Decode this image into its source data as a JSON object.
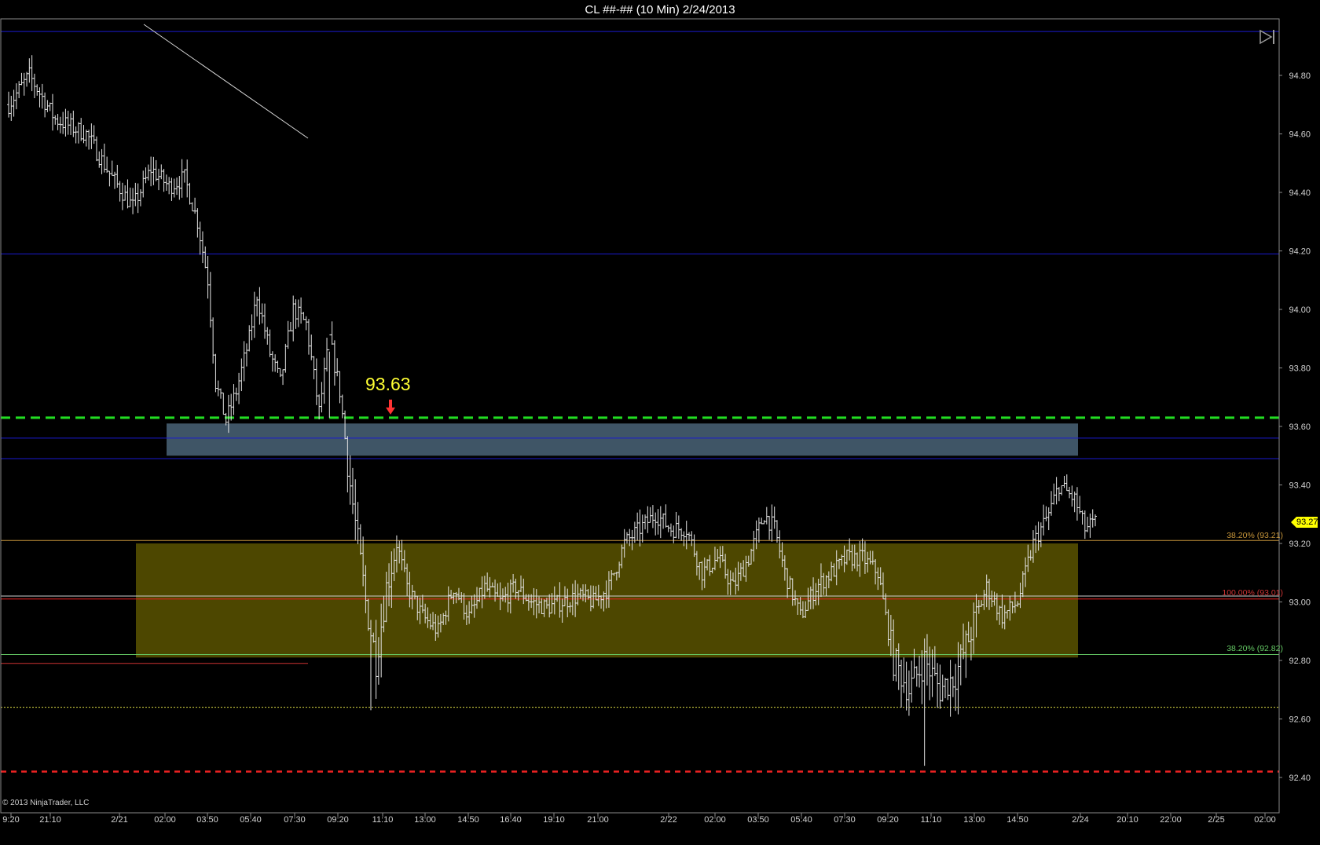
{
  "window": {
    "title": "CL ##-## (10 Min)  2/24/2013"
  },
  "footer": {
    "copyright": "© 2013 NinjaTrader, LLC"
  },
  "current_price": "93.27",
  "annotation": {
    "text": "93.63"
  },
  "fib_labels": {
    "upper": "38.20% (93.21)",
    "middle": "100.00% (93.01)",
    "lower": "38.20% (92.82)"
  },
  "colors": {
    "background": "#000000",
    "bars": "#e6e6e6",
    "blue_level": "#1a1ad0",
    "green_level": "#22dd22",
    "red_level": "#ee2222",
    "steel_zone": "#3f5566",
    "olive_zone": "#4d4700",
    "fib_orange": "#c8963a",
    "fib_red": "#cc3333",
    "fib_green": "#66cc66"
  },
  "chart_data": {
    "type": "bar",
    "subtype": "ohlc",
    "title": "CL ##-## (10 Min)  2/24/2013",
    "ylim": [
      92.24,
      94.98
    ],
    "y_ticks": [
      "94.80",
      "94.60",
      "94.40",
      "94.20",
      "94.00",
      "93.80",
      "93.60",
      "93.40",
      "93.20",
      "93.00",
      "92.80",
      "92.60",
      "92.40"
    ],
    "x_ticks": [
      "9:20",
      "21:10",
      "2/21",
      "02:00",
      "03:50",
      "05:40",
      "07:30",
      "09:20",
      "11:10",
      "13:00",
      "14:50",
      "16:40",
      "19:10",
      "21:00",
      "2/22",
      "02:00",
      "03:50",
      "05:40",
      "07:30",
      "09:20",
      "11:10",
      "13:00",
      "14:50",
      "2/24",
      "20:10",
      "22:00",
      "2/25",
      "02:00"
    ],
    "grid": false,
    "horizontal_levels": [
      {
        "price": 94.95,
        "style": "solid",
        "color": "blue"
      },
      {
        "price": 94.19,
        "style": "solid",
        "color": "blue"
      },
      {
        "price": 93.63,
        "style": "dashed",
        "color": "green"
      },
      {
        "price": 93.56,
        "style": "solid",
        "color": "blue"
      },
      {
        "price": 93.49,
        "style": "solid",
        "color": "blue"
      },
      {
        "price": 93.21,
        "style": "solid",
        "color": "orange"
      },
      {
        "price": 93.01,
        "style": "solid",
        "color": "red"
      },
      {
        "price": 92.82,
        "style": "solid",
        "color": "green"
      },
      {
        "price": 92.64,
        "style": "dotted",
        "color": "yellow"
      },
      {
        "price": 92.42,
        "style": "dashed",
        "color": "red"
      }
    ],
    "zones": [
      {
        "name": "steel",
        "price_top": 93.61,
        "price_bottom": 93.5
      },
      {
        "name": "olive",
        "price_top": 93.2,
        "price_bottom": 92.81
      }
    ],
    "callout_price": 93.63,
    "last_price": 93.27,
    "anchors": [
      {
        "i": 0,
        "p": 94.7
      },
      {
        "i": 8,
        "p": 94.8
      },
      {
        "i": 18,
        "p": 94.65
      },
      {
        "i": 30,
        "p": 94.6
      },
      {
        "i": 40,
        "p": 94.45
      },
      {
        "i": 48,
        "p": 94.35
      },
      {
        "i": 55,
        "p": 94.48
      },
      {
        "i": 62,
        "p": 94.42
      },
      {
        "i": 68,
        "p": 94.45
      },
      {
        "i": 73,
        "p": 94.3
      },
      {
        "i": 77,
        "p": 94.1
      },
      {
        "i": 80,
        "p": 93.75
      },
      {
        "i": 84,
        "p": 93.62
      },
      {
        "i": 88,
        "p": 93.72
      },
      {
        "i": 93,
        "p": 93.9
      },
      {
        "i": 96,
        "p": 94.05
      },
      {
        "i": 101,
        "p": 93.85
      },
      {
        "i": 105,
        "p": 93.75
      },
      {
        "i": 110,
        "p": 94.0
      },
      {
        "i": 115,
        "p": 93.95
      },
      {
        "i": 120,
        "p": 93.65
      },
      {
        "i": 124,
        "p": 93.9
      },
      {
        "i": 128,
        "p": 93.72
      },
      {
        "i": 132,
        "p": 93.4
      },
      {
        "i": 138,
        "p": 93.0
      },
      {
        "i": 142,
        "p": 92.8
      },
      {
        "i": 146,
        "p": 93.05
      },
      {
        "i": 150,
        "p": 93.2
      },
      {
        "i": 154,
        "p": 93.05
      },
      {
        "i": 160,
        "p": 92.95
      },
      {
        "i": 166,
        "p": 92.9
      },
      {
        "i": 172,
        "p": 93.05
      },
      {
        "i": 178,
        "p": 92.95
      },
      {
        "i": 184,
        "p": 93.05
      },
      {
        "i": 190,
        "p": 93.0
      },
      {
        "i": 196,
        "p": 93.05
      },
      {
        "i": 202,
        "p": 93.0
      },
      {
        "i": 208,
        "p": 92.98
      },
      {
        "i": 214,
        "p": 93.0
      },
      {
        "i": 220,
        "p": 93.02
      },
      {
        "i": 226,
        "p": 93.0
      },
      {
        "i": 232,
        "p": 93.05
      },
      {
        "i": 238,
        "p": 93.2
      },
      {
        "i": 244,
        "p": 93.25
      },
      {
        "i": 250,
        "p": 93.3
      },
      {
        "i": 256,
        "p": 93.25
      },
      {
        "i": 262,
        "p": 93.25
      },
      {
        "i": 268,
        "p": 93.1
      },
      {
        "i": 274,
        "p": 93.15
      },
      {
        "i": 280,
        "p": 93.05
      },
      {
        "i": 286,
        "p": 93.15
      },
      {
        "i": 292,
        "p": 93.3
      },
      {
        "i": 296,
        "p": 93.25
      },
      {
        "i": 300,
        "p": 93.1
      },
      {
        "i": 306,
        "p": 92.95
      },
      {
        "i": 312,
        "p": 93.05
      },
      {
        "i": 318,
        "p": 93.1
      },
      {
        "i": 324,
        "p": 93.15
      },
      {
        "i": 330,
        "p": 93.15
      },
      {
        "i": 336,
        "p": 93.1
      },
      {
        "i": 342,
        "p": 92.8
      },
      {
        "i": 348,
        "p": 92.7
      },
      {
        "i": 354,
        "p": 92.8
      },
      {
        "i": 360,
        "p": 92.7
      },
      {
        "i": 366,
        "p": 92.75
      },
      {
        "i": 372,
        "p": 92.9
      },
      {
        "i": 378,
        "p": 93.05
      },
      {
        "i": 384,
        "p": 92.95
      },
      {
        "i": 390,
        "p": 93.0
      },
      {
        "i": 396,
        "p": 93.2
      },
      {
        "i": 402,
        "p": 93.3
      },
      {
        "i": 406,
        "p": 93.4
      },
      {
        "i": 412,
        "p": 93.35
      },
      {
        "i": 416,
        "p": 93.25
      },
      {
        "i": 420,
        "p": 93.27
      }
    ]
  }
}
